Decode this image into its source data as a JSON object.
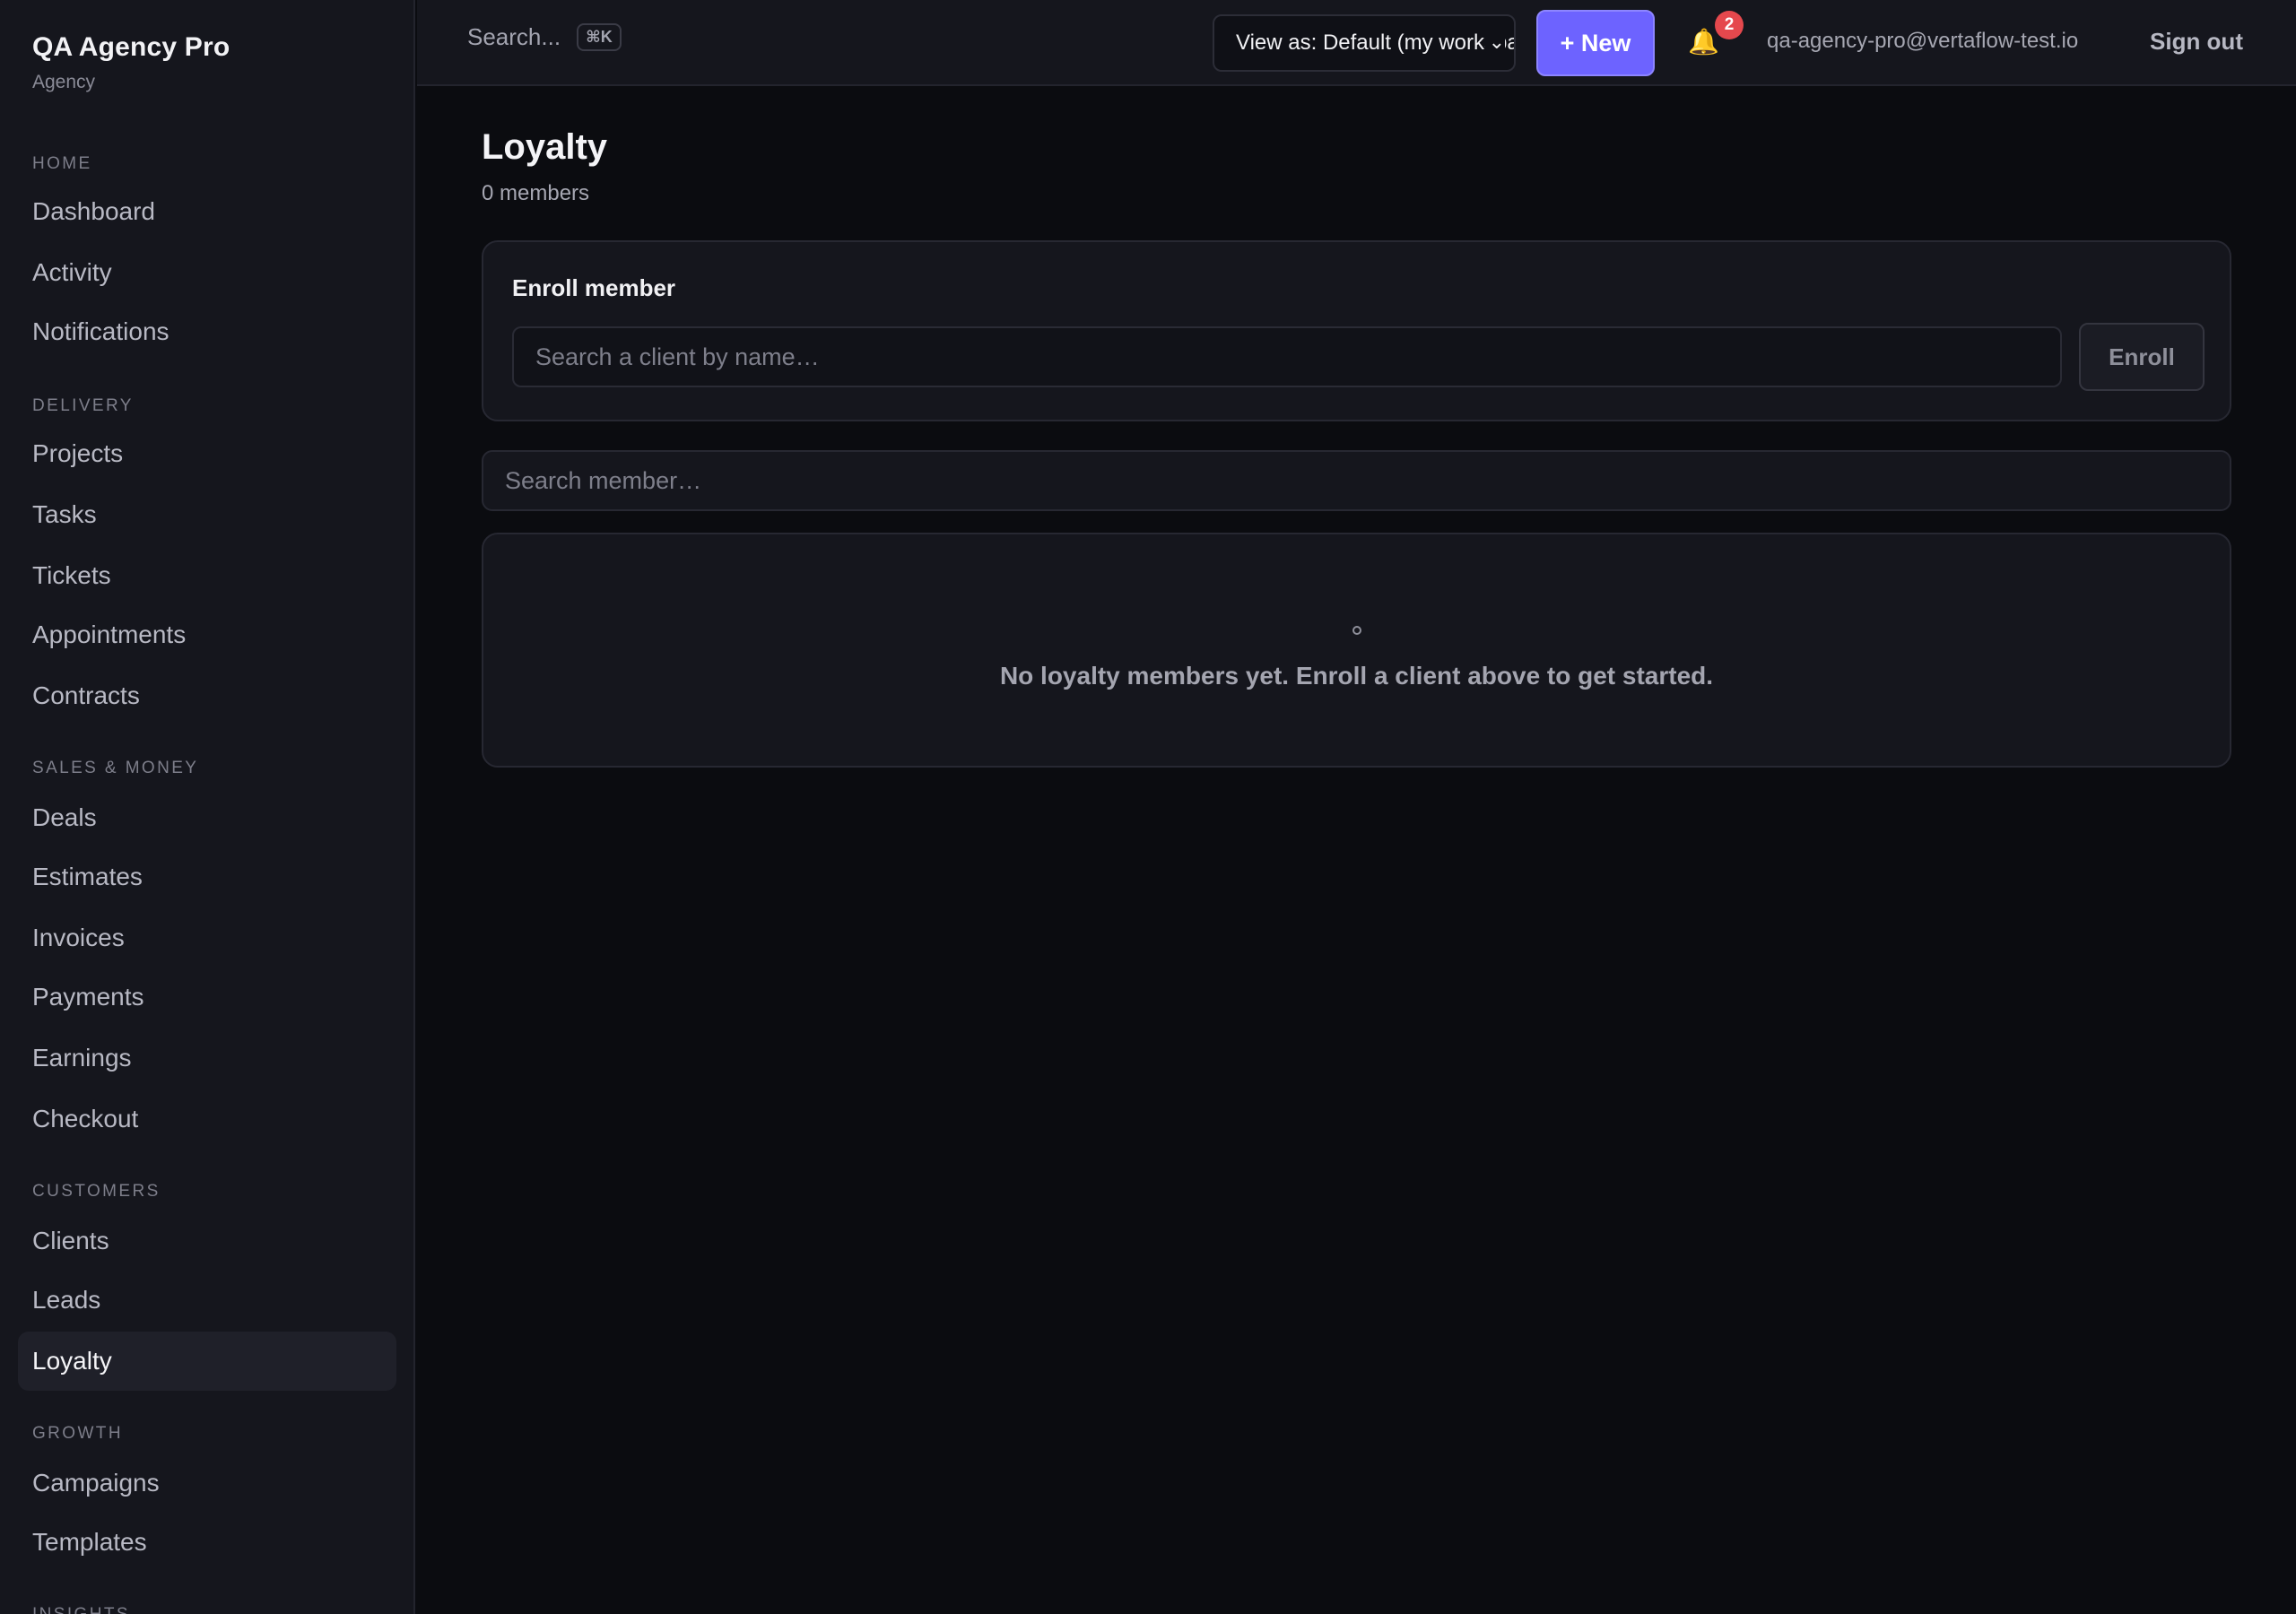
{
  "brand": {
    "name": "QA Agency Pro",
    "subtitle": "Agency"
  },
  "sidebar": {
    "groups": [
      {
        "label": "HOME",
        "items": [
          "Dashboard",
          "Activity",
          "Notifications"
        ]
      },
      {
        "label": "DELIVERY",
        "items": [
          "Projects",
          "Tasks",
          "Tickets",
          "Appointments",
          "Contracts"
        ]
      },
      {
        "label": "SALES & MONEY",
        "items": [
          "Deals",
          "Estimates",
          "Invoices",
          "Payments",
          "Earnings",
          "Checkout"
        ]
      },
      {
        "label": "CUSTOMERS",
        "items": [
          "Clients",
          "Leads",
          "Loyalty"
        ]
      },
      {
        "label": "GROWTH",
        "items": [
          "Campaigns",
          "Templates"
        ]
      },
      {
        "label": "INSIGHTS",
        "items": []
      }
    ],
    "active_item": "Loyalty"
  },
  "topbar": {
    "search_label": "Search...",
    "search_shortcut": "⌘K",
    "view_as": "View as: Default (my workspace)",
    "new_label": "+ New",
    "notification_count": "2",
    "user_email": "qa-agency-pro@vertaflow-test.io",
    "signout_label": "Sign out"
  },
  "page": {
    "title": "Loyalty",
    "member_count": "0 members"
  },
  "enroll": {
    "title": "Enroll member",
    "placeholder": "Search a client by name…",
    "button": "Enroll"
  },
  "member_search": {
    "placeholder": "Search member…"
  },
  "empty_state": {
    "message": "No loyalty members yet. Enroll a client above to get started."
  },
  "colors": {
    "accent": "#6d63ff",
    "badge": "#e5484d",
    "background": "#0b0c10",
    "panel": "#15161d"
  }
}
